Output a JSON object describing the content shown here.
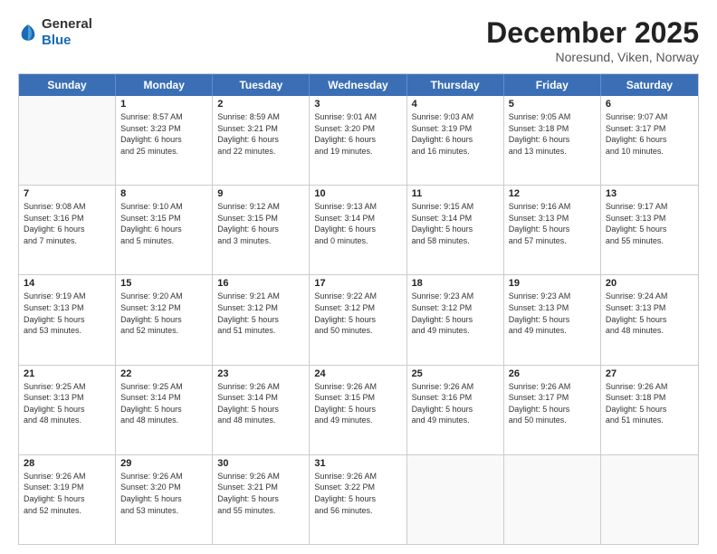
{
  "header": {
    "logo_general": "General",
    "logo_blue": "Blue",
    "month": "December 2025",
    "location": "Noresund, Viken, Norway"
  },
  "weekdays": [
    "Sunday",
    "Monday",
    "Tuesday",
    "Wednesday",
    "Thursday",
    "Friday",
    "Saturday"
  ],
  "rows": [
    [
      {
        "day": "",
        "sunrise": "",
        "sunset": "",
        "daylight": ""
      },
      {
        "day": "1",
        "sunrise": "Sunrise: 8:57 AM",
        "sunset": "Sunset: 3:23 PM",
        "daylight": "Daylight: 6 hours and 25 minutes."
      },
      {
        "day": "2",
        "sunrise": "Sunrise: 8:59 AM",
        "sunset": "Sunset: 3:21 PM",
        "daylight": "Daylight: 6 hours and 22 minutes."
      },
      {
        "day": "3",
        "sunrise": "Sunrise: 9:01 AM",
        "sunset": "Sunset: 3:20 PM",
        "daylight": "Daylight: 6 hours and 19 minutes."
      },
      {
        "day": "4",
        "sunrise": "Sunrise: 9:03 AM",
        "sunset": "Sunset: 3:19 PM",
        "daylight": "Daylight: 6 hours and 16 minutes."
      },
      {
        "day": "5",
        "sunrise": "Sunrise: 9:05 AM",
        "sunset": "Sunset: 3:18 PM",
        "daylight": "Daylight: 6 hours and 13 minutes."
      },
      {
        "day": "6",
        "sunrise": "Sunrise: 9:07 AM",
        "sunset": "Sunset: 3:17 PM",
        "daylight": "Daylight: 6 hours and 10 minutes."
      }
    ],
    [
      {
        "day": "7",
        "sunrise": "Sunrise: 9:08 AM",
        "sunset": "Sunset: 3:16 PM",
        "daylight": "Daylight: 6 hours and 7 minutes."
      },
      {
        "day": "8",
        "sunrise": "Sunrise: 9:10 AM",
        "sunset": "Sunset: 3:15 PM",
        "daylight": "Daylight: 6 hours and 5 minutes."
      },
      {
        "day": "9",
        "sunrise": "Sunrise: 9:12 AM",
        "sunset": "Sunset: 3:15 PM",
        "daylight": "Daylight: 6 hours and 3 minutes."
      },
      {
        "day": "10",
        "sunrise": "Sunrise: 9:13 AM",
        "sunset": "Sunset: 3:14 PM",
        "daylight": "Daylight: 6 hours and 0 minutes."
      },
      {
        "day": "11",
        "sunrise": "Sunrise: 9:15 AM",
        "sunset": "Sunset: 3:14 PM",
        "daylight": "Daylight: 5 hours and 58 minutes."
      },
      {
        "day": "12",
        "sunrise": "Sunrise: 9:16 AM",
        "sunset": "Sunset: 3:13 PM",
        "daylight": "Daylight: 5 hours and 57 minutes."
      },
      {
        "day": "13",
        "sunrise": "Sunrise: 9:17 AM",
        "sunset": "Sunset: 3:13 PM",
        "daylight": "Daylight: 5 hours and 55 minutes."
      }
    ],
    [
      {
        "day": "14",
        "sunrise": "Sunrise: 9:19 AM",
        "sunset": "Sunset: 3:13 PM",
        "daylight": "Daylight: 5 hours and 53 minutes."
      },
      {
        "day": "15",
        "sunrise": "Sunrise: 9:20 AM",
        "sunset": "Sunset: 3:12 PM",
        "daylight": "Daylight: 5 hours and 52 minutes."
      },
      {
        "day": "16",
        "sunrise": "Sunrise: 9:21 AM",
        "sunset": "Sunset: 3:12 PM",
        "daylight": "Daylight: 5 hours and 51 minutes."
      },
      {
        "day": "17",
        "sunrise": "Sunrise: 9:22 AM",
        "sunset": "Sunset: 3:12 PM",
        "daylight": "Daylight: 5 hours and 50 minutes."
      },
      {
        "day": "18",
        "sunrise": "Sunrise: 9:23 AM",
        "sunset": "Sunset: 3:12 PM",
        "daylight": "Daylight: 5 hours and 49 minutes."
      },
      {
        "day": "19",
        "sunrise": "Sunrise: 9:23 AM",
        "sunset": "Sunset: 3:13 PM",
        "daylight": "Daylight: 5 hours and 49 minutes."
      },
      {
        "day": "20",
        "sunrise": "Sunrise: 9:24 AM",
        "sunset": "Sunset: 3:13 PM",
        "daylight": "Daylight: 5 hours and 48 minutes."
      }
    ],
    [
      {
        "day": "21",
        "sunrise": "Sunrise: 9:25 AM",
        "sunset": "Sunset: 3:13 PM",
        "daylight": "Daylight: 5 hours and 48 minutes."
      },
      {
        "day": "22",
        "sunrise": "Sunrise: 9:25 AM",
        "sunset": "Sunset: 3:14 PM",
        "daylight": "Daylight: 5 hours and 48 minutes."
      },
      {
        "day": "23",
        "sunrise": "Sunrise: 9:26 AM",
        "sunset": "Sunset: 3:14 PM",
        "daylight": "Daylight: 5 hours and 48 minutes."
      },
      {
        "day": "24",
        "sunrise": "Sunrise: 9:26 AM",
        "sunset": "Sunset: 3:15 PM",
        "daylight": "Daylight: 5 hours and 49 minutes."
      },
      {
        "day": "25",
        "sunrise": "Sunrise: 9:26 AM",
        "sunset": "Sunset: 3:16 PM",
        "daylight": "Daylight: 5 hours and 49 minutes."
      },
      {
        "day": "26",
        "sunrise": "Sunrise: 9:26 AM",
        "sunset": "Sunset: 3:17 PM",
        "daylight": "Daylight: 5 hours and 50 minutes."
      },
      {
        "day": "27",
        "sunrise": "Sunrise: 9:26 AM",
        "sunset": "Sunset: 3:18 PM",
        "daylight": "Daylight: 5 hours and 51 minutes."
      }
    ],
    [
      {
        "day": "28",
        "sunrise": "Sunrise: 9:26 AM",
        "sunset": "Sunset: 3:19 PM",
        "daylight": "Daylight: 5 hours and 52 minutes."
      },
      {
        "day": "29",
        "sunrise": "Sunrise: 9:26 AM",
        "sunset": "Sunset: 3:20 PM",
        "daylight": "Daylight: 5 hours and 53 minutes."
      },
      {
        "day": "30",
        "sunrise": "Sunrise: 9:26 AM",
        "sunset": "Sunset: 3:21 PM",
        "daylight": "Daylight: 5 hours and 55 minutes."
      },
      {
        "day": "31",
        "sunrise": "Sunrise: 9:26 AM",
        "sunset": "Sunset: 3:22 PM",
        "daylight": "Daylight: 5 hours and 56 minutes."
      },
      {
        "day": "",
        "sunrise": "",
        "sunset": "",
        "daylight": ""
      },
      {
        "day": "",
        "sunrise": "",
        "sunset": "",
        "daylight": ""
      },
      {
        "day": "",
        "sunrise": "",
        "sunset": "",
        "daylight": ""
      }
    ]
  ]
}
